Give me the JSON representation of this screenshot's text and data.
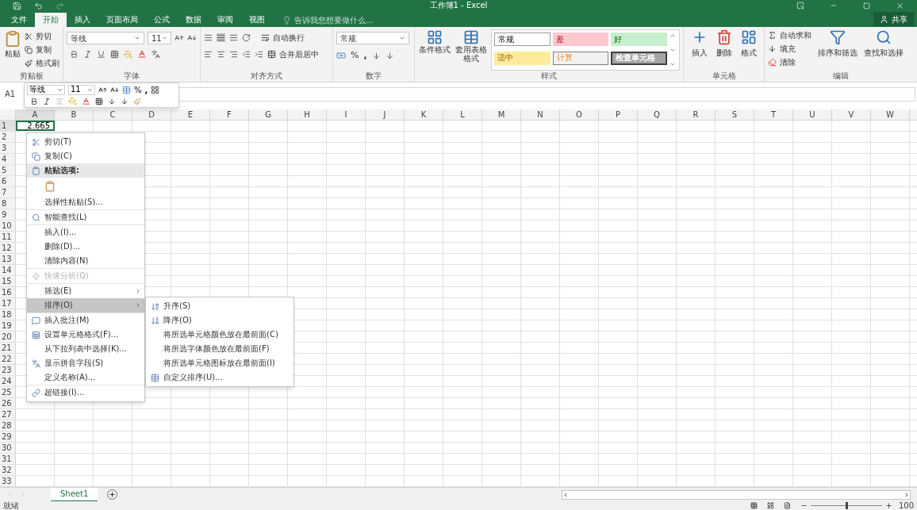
{
  "window": {
    "title": "工作簿1 - Excel"
  },
  "tabs": [
    {
      "label": "文件",
      "selected": false
    },
    {
      "label": "开始",
      "selected": true
    },
    {
      "label": "插入",
      "selected": false
    },
    {
      "label": "页面布局",
      "selected": false
    },
    {
      "label": "公式",
      "selected": false
    },
    {
      "label": "数据",
      "selected": false
    },
    {
      "label": "审阅",
      "selected": false
    },
    {
      "label": "视图",
      "selected": false
    }
  ],
  "tell_me": {
    "placeholder": "告诉我您想要做什么..."
  },
  "share": "共享",
  "ribbon": {
    "clipboard": {
      "label": "剪贴板",
      "paste": "粘贴",
      "items": [
        "剪切",
        "复制",
        "格式刷"
      ]
    },
    "font": {
      "label": "字体",
      "name": "等线",
      "size": "11"
    },
    "alignment": {
      "label": "对齐方式",
      "wrap": "自动换行",
      "merge": "合并后居中"
    },
    "number": {
      "label": "数字",
      "format": "常规",
      "percent": "%",
      "comma": ","
    },
    "styles": {
      "label": "样式",
      "buttons": [
        "条件格式",
        "套用表格格式"
      ],
      "cells": [
        {
          "label": "常规",
          "kind": "normal"
        },
        {
          "label": "差",
          "kind": "bad"
        },
        {
          "label": "好",
          "kind": "good"
        },
        {
          "label": "适中",
          "kind": "neutral"
        },
        {
          "label": "计算",
          "kind": "calculation"
        },
        {
          "label": "检查单元格",
          "kind": "check"
        }
      ]
    },
    "cells": {
      "label": "单元格",
      "buttons": [
        "插入",
        "删除",
        "格式"
      ]
    },
    "editing": {
      "label": "编辑",
      "items": [
        "自动求和",
        "填充",
        "清除"
      ],
      "buttons": [
        "排序和筛选",
        "查找和选择"
      ]
    }
  },
  "name_box": "A1",
  "mini_toolbar": {
    "font": "等线",
    "size": "11",
    "percent": "%",
    "comma": ","
  },
  "grid": {
    "columns": [
      "A",
      "B",
      "C",
      "D",
      "E",
      "F",
      "G",
      "H",
      "I",
      "J",
      "K",
      "L",
      "M",
      "N",
      "O",
      "P",
      "Q",
      "R",
      "S",
      "T",
      "U",
      "V",
      "W"
    ],
    "rows": [
      "1",
      "2",
      "3",
      "4",
      "5",
      "6",
      "7",
      "8",
      "9",
      "10",
      "11",
      "12",
      "13",
      "14",
      "15",
      "16",
      "17",
      "18",
      "19",
      "20",
      "21",
      "22",
      "23",
      "24",
      "25",
      "26",
      "27",
      "28",
      "29",
      "30",
      "31",
      "32",
      "33"
    ],
    "active_cell_value": "2.665"
  },
  "context_menu": {
    "groups": [
      [
        {
          "label": "剪切(T)",
          "kind": "item",
          "disabled": false,
          "selected": false,
          "submenu": false
        },
        {
          "label": "复制(C)",
          "kind": "item",
          "disabled": false,
          "selected": false,
          "submenu": false
        },
        {
          "label": "粘贴选项:",
          "kind": "header"
        },
        {
          "kind": "paste_icons"
        },
        {
          "label": "选择性粘贴(S)...",
          "kind": "item",
          "disabled": false,
          "selected": false,
          "submenu": false
        }
      ],
      [
        {
          "label": "智能查找(L)",
          "kind": "item",
          "disabled": false,
          "selected": false,
          "submenu": false
        }
      ],
      [
        {
          "label": "插入(I)...",
          "kind": "item",
          "disabled": false,
          "selected": false,
          "submenu": false
        },
        {
          "label": "删除(D)...",
          "kind": "item",
          "disabled": false,
          "selected": false,
          "submenu": false
        },
        {
          "label": "清除内容(N)",
          "kind": "item",
          "disabled": false,
          "selected": false,
          "submenu": false
        }
      ],
      [
        {
          "label": "快速分析(Q)",
          "kind": "item",
          "disabled": true,
          "selected": false,
          "submenu": false
        }
      ],
      [
        {
          "label": "筛选(E)",
          "kind": "item",
          "disabled": false,
          "selected": false,
          "submenu": true
        },
        {
          "label": "排序(O)",
          "kind": "item",
          "disabled": false,
          "selected": true,
          "submenu": true
        }
      ],
      [
        {
          "label": "插入批注(M)",
          "kind": "item",
          "disabled": false,
          "selected": false,
          "submenu": false
        },
        {
          "label": "设置单元格格式(F)...",
          "kind": "item",
          "disabled": false,
          "selected": false,
          "submenu": false
        },
        {
          "label": "从下拉列表中选择(K)...",
          "kind": "item",
          "disabled": false,
          "selected": false,
          "submenu": false
        },
        {
          "label": "显示拼音字段(S)",
          "kind": "item",
          "disabled": false,
          "selected": false,
          "submenu": false
        },
        {
          "label": "定义名称(A)...",
          "kind": "item",
          "disabled": false,
          "selected": false,
          "submenu": false
        }
      ],
      [
        {
          "label": "超链接(I)...",
          "kind": "item",
          "disabled": false,
          "selected": false,
          "submenu": false
        }
      ]
    ]
  },
  "sort_submenu": {
    "items": [
      "升序(S)",
      "降序(O)",
      "将所选单元格颜色放在最前面(C)",
      "将所选字体颜色放在最前面(F)",
      "将所选单元格图标放在最前面(I)",
      "自定义排序(U)..."
    ]
  },
  "sheet_tabs": [
    {
      "label": "Sheet1",
      "selected": true
    }
  ],
  "status_bar": {
    "status": "就绪",
    "zoom": "100",
    "zoom_slider": {
      "level": 0.5
    }
  }
}
